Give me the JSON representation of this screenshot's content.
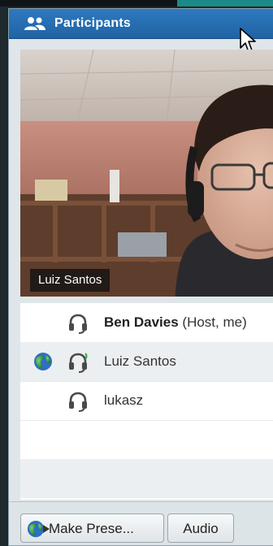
{
  "panel": {
    "title": "Participants",
    "title_icon": "people-icon"
  },
  "video": {
    "name_label": "Luiz Santos"
  },
  "participants": [
    {
      "name": "Ben Davies",
      "role": "(Host, me)",
      "has_globe": false,
      "headset_status": "headset-icon"
    },
    {
      "name": "Luiz Santos",
      "role": "",
      "has_globe": true,
      "headset_status": "headset-active-icon"
    },
    {
      "name": "lukasz",
      "role": "",
      "has_globe": false,
      "headset_status": "headset-icon"
    }
  ],
  "buttons": {
    "make_presenter_label": "Make Prese...",
    "audio_label": "Audio"
  },
  "colors": {
    "titlebar": "#2a72b8",
    "globe_green": "#3aa63a",
    "globe_blue": "#2f6fc0",
    "active_status": "#2fa84a"
  }
}
